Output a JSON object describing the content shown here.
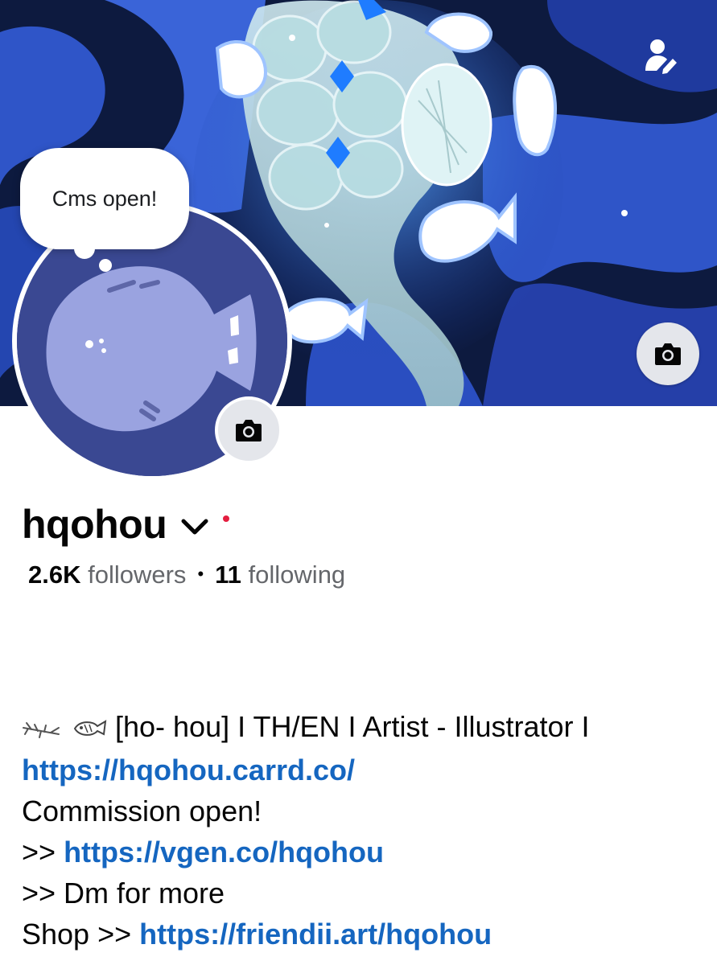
{
  "cover": {
    "description_icons": [
      "edit-profile-icon",
      "camera-icon"
    ]
  },
  "note": {
    "text": "Cms open!"
  },
  "profile": {
    "name": "hqohou",
    "followers_count": "2.6K",
    "followers_label": "followers",
    "separator": "•",
    "following_count": "11",
    "following_label": "following"
  },
  "bio": {
    "line1_text": "[ho- hou] I TH/EN I Artist - Illustrator I",
    "link1": "https://hqohou.carrd.co/",
    "line3": "Commission open!",
    "line4_prefix": ">> ",
    "link2": "https://vgen.co/hqohou",
    "line5": ">> Dm for more",
    "line6_prefix": "Shop >> ",
    "link3": "https://friendii.art/hqohou"
  },
  "colors": {
    "link": "#1566c0",
    "status_dot": "#e41e3f",
    "avatar_bg": "#3a4892",
    "cover_bg": "#0d1a3f"
  }
}
